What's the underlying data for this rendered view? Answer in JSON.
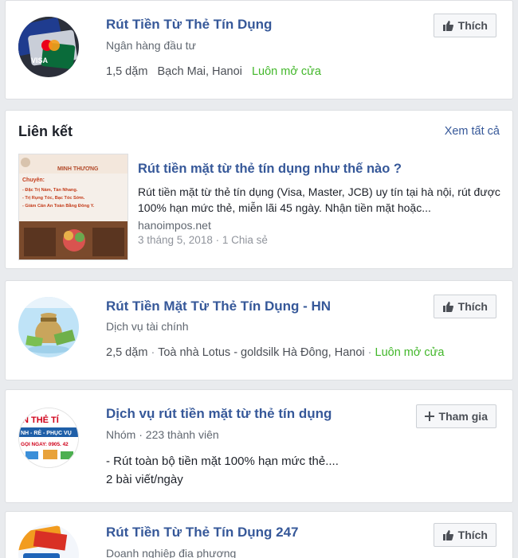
{
  "cards": [
    {
      "title": "Rút Tiền Từ Thẻ Tín Dụng",
      "category": "Ngân hàng đầu tư",
      "distance": "1,5 dặm",
      "address": "Bạch Mai, Hanoi",
      "status": "Luôn mở cửa",
      "button": "Thích"
    },
    {
      "title": "Rút Tiền Mặt Từ Thẻ Tín Dụng - HN",
      "category": "Dịch vụ tài chính",
      "distance": "2,5 dặm",
      "separator": "·",
      "address": "Toà nhà Lotus - goldsilk Hà Đông, Hanoi",
      "status": "Luôn mở cửa",
      "button": "Thích"
    },
    {
      "title": "Dịch vụ rút tiền mặt từ thẻ tín dụng",
      "category": "Nhóm · 223 thành viên",
      "line1": "- Rút toàn bộ tiền mặt 100% hạn mức thẻ....",
      "line2": "2 bài viết/ngày",
      "button": "Tham gia",
      "avatar_text": {
        "top": "N THẺ TÍ",
        "mid": "NH - RẺ - PHỤC VỤ",
        "phone": "GỌI NGAY: 0905. 42"
      }
    },
    {
      "title": "Rút Tiền Từ Thẻ Tín Dụng 247",
      "category": "Doanh nghiệp địa phương",
      "button": "Thích"
    }
  ],
  "links": {
    "section_title": "Liên kết",
    "see_all": "Xem tất cả",
    "item": {
      "title": "Rút tiền mặt từ thẻ tín dụng như thế nào ?",
      "description": "Rút tiền mặt từ thẻ tín dụng (Visa, Master, JCB) uy tín tại hà nội, rút được 100% hạn mức thẻ, miễn lãi 45 ngày. Nhận tiền mặt hoặc...",
      "domain": "hanoimpos.net",
      "date": "3 tháng 5, 2018",
      "dot": "·",
      "shares": "1 Chia sẻ",
      "thumb_text": {
        "brand": "MINH THƯƠNG",
        "heading": "Chuyên:",
        "l1": "- Đặc Trị Nám, Tàn Nhang.",
        "l2": "- Trị Rụng Tóc, Bạc Tóc Sớm.",
        "l3": "- Giảm Cân An Toàn Bằng Đông Y."
      }
    }
  },
  "colors": {
    "link": "#365899",
    "open": "#42b72a",
    "page_bg": "#e9ebee"
  },
  "icons": {
    "like": "thumbs-up-icon",
    "join": "plus-icon"
  }
}
